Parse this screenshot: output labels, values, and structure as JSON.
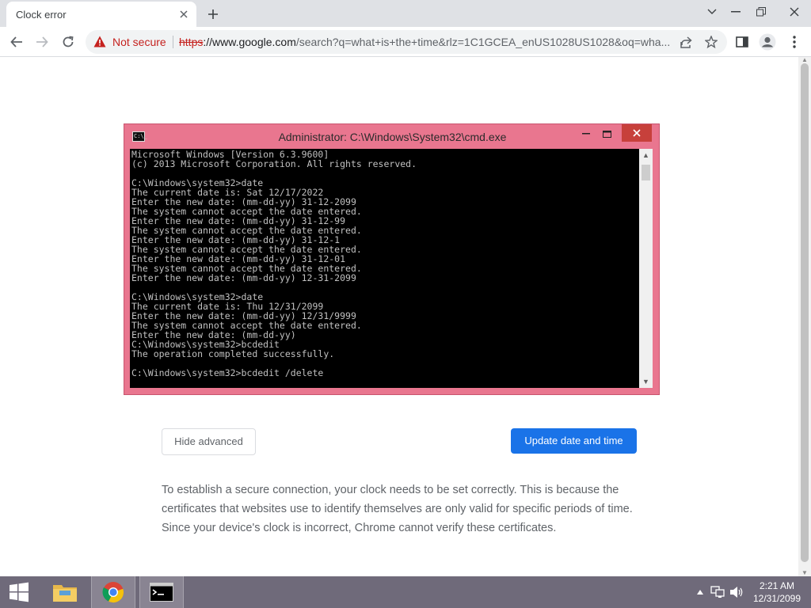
{
  "browser": {
    "tab_title": "Clock error",
    "security_label": "Not secure",
    "url_scheme": "https",
    "url_host": "://www.google.com",
    "url_rest": "/search?q=what+is+the+time&rlz=1C1GCEA_enUS1028US1028&oq=wha..."
  },
  "cmd": {
    "title": "Administrator: C:\\Windows\\System32\\cmd.exe",
    "lines": [
      "Microsoft Windows [Version 6.3.9600]",
      "(c) 2013 Microsoft Corporation. All rights reserved.",
      "",
      "C:\\Windows\\system32>date",
      "The current date is: Sat 12/17/2022",
      "Enter the new date: (mm-dd-yy) 31-12-2099",
      "The system cannot accept the date entered.",
      "Enter the new date: (mm-dd-yy) 31-12-99",
      "The system cannot accept the date entered.",
      "Enter the new date: (mm-dd-yy) 31-12-1",
      "The system cannot accept the date entered.",
      "Enter the new date: (mm-dd-yy) 31-12-01",
      "The system cannot accept the date entered.",
      "Enter the new date: (mm-dd-yy) 12-31-2099",
      "",
      "C:\\Windows\\system32>date",
      "The current date is: Thu 12/31/2099",
      "Enter the new date: (mm-dd-yy) 12/31/9999",
      "The system cannot accept the date entered.",
      "Enter the new date: (mm-dd-yy)",
      "C:\\Windows\\system32>bcdedit",
      "The operation completed successfully.",
      "",
      "C:\\Windows\\system32>bcdedit /delete"
    ]
  },
  "actions": {
    "hide_advanced": "Hide advanced",
    "update_date_time": "Update date and time"
  },
  "explanation": "To establish a secure connection, your clock needs to be set correctly. This is because the certificates that websites use to identify themselves are only valid for specific periods of time. Since your device's clock is incorrect, Chrome cannot verify these certificates.",
  "taskbar": {
    "time": "2:21 AM",
    "date": "12/31/2099"
  },
  "icons": {
    "tab_close": "close-icon",
    "new_tab": "plus-icon",
    "back": "back-arrow-icon",
    "forward": "forward-arrow-icon",
    "reload": "reload-icon",
    "warning": "warning-icon",
    "share": "share-icon",
    "bookmark": "star-icon",
    "side_panel": "side-panel-icon",
    "profile": "profile-icon",
    "menu": "kebab-menu-icon"
  },
  "colors": {
    "accent": "#1a73e8",
    "not_secure": "#c5221f",
    "cmd_frame": "#e9768f",
    "taskbar": "#6f6a7a"
  }
}
